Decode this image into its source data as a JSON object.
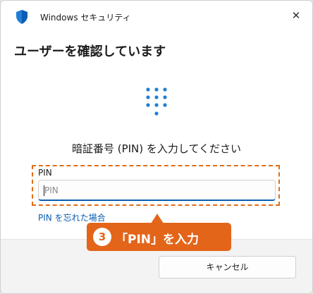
{
  "window": {
    "title": "Windows セキュリティ",
    "close_icon": "close-icon"
  },
  "heading": "ユーザーを確認しています",
  "prompt": "暗証番号 (PIN) を入力してください",
  "pin_field": {
    "label": "PIN",
    "placeholder": "PIN",
    "value": ""
  },
  "forgot_link": "PIN を忘れた場合",
  "cancel_label": "キャンセル",
  "callout": {
    "number": "3",
    "text": "「PIN」を入力"
  },
  "colors": {
    "accent": "#0a5eb1",
    "callout": "#e3651a",
    "keypad_dots": "#1f7fd8"
  }
}
